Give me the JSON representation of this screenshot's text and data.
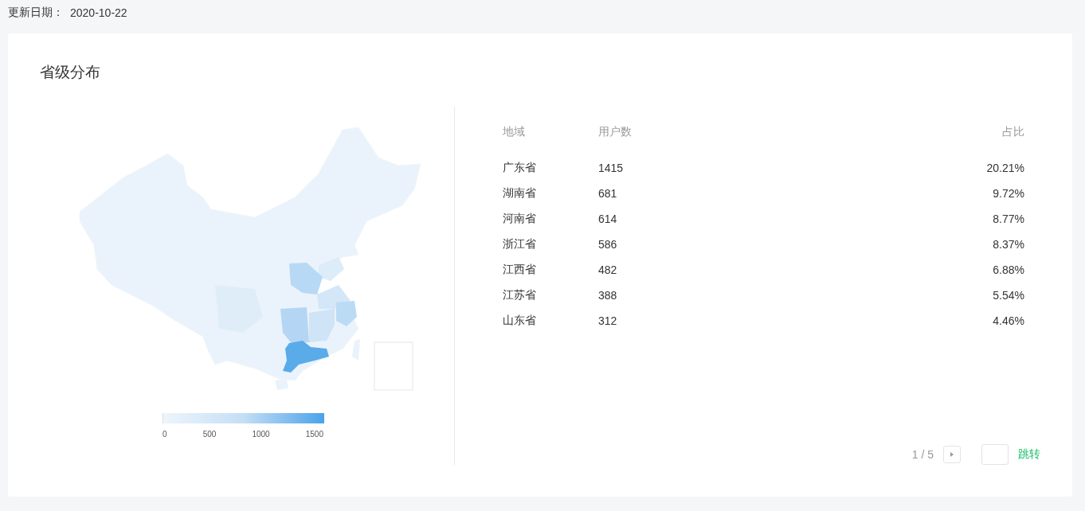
{
  "update": {
    "label": "更新日期：",
    "date": "2020-10-22"
  },
  "card": {
    "title": "省级分布",
    "legend": {
      "ticks": [
        "0",
        "500",
        "1000",
        "1500"
      ]
    },
    "table": {
      "columns": [
        "地域",
        "用户数",
        "占比"
      ],
      "rows": [
        {
          "region": "广东省",
          "users": "1415",
          "share": "20.21%"
        },
        {
          "region": "湖南省",
          "users": "681",
          "share": "9.72%"
        },
        {
          "region": "河南省",
          "users": "614",
          "share": "8.77%"
        },
        {
          "region": "浙江省",
          "users": "586",
          "share": "8.37%"
        },
        {
          "region": "江西省",
          "users": "482",
          "share": "6.88%"
        },
        {
          "region": "江苏省",
          "users": "388",
          "share": "5.54%"
        },
        {
          "region": "山东省",
          "users": "312",
          "share": "4.46%"
        }
      ]
    },
    "pagination": {
      "page": "1 / 5",
      "jump": "跳转"
    }
  }
}
